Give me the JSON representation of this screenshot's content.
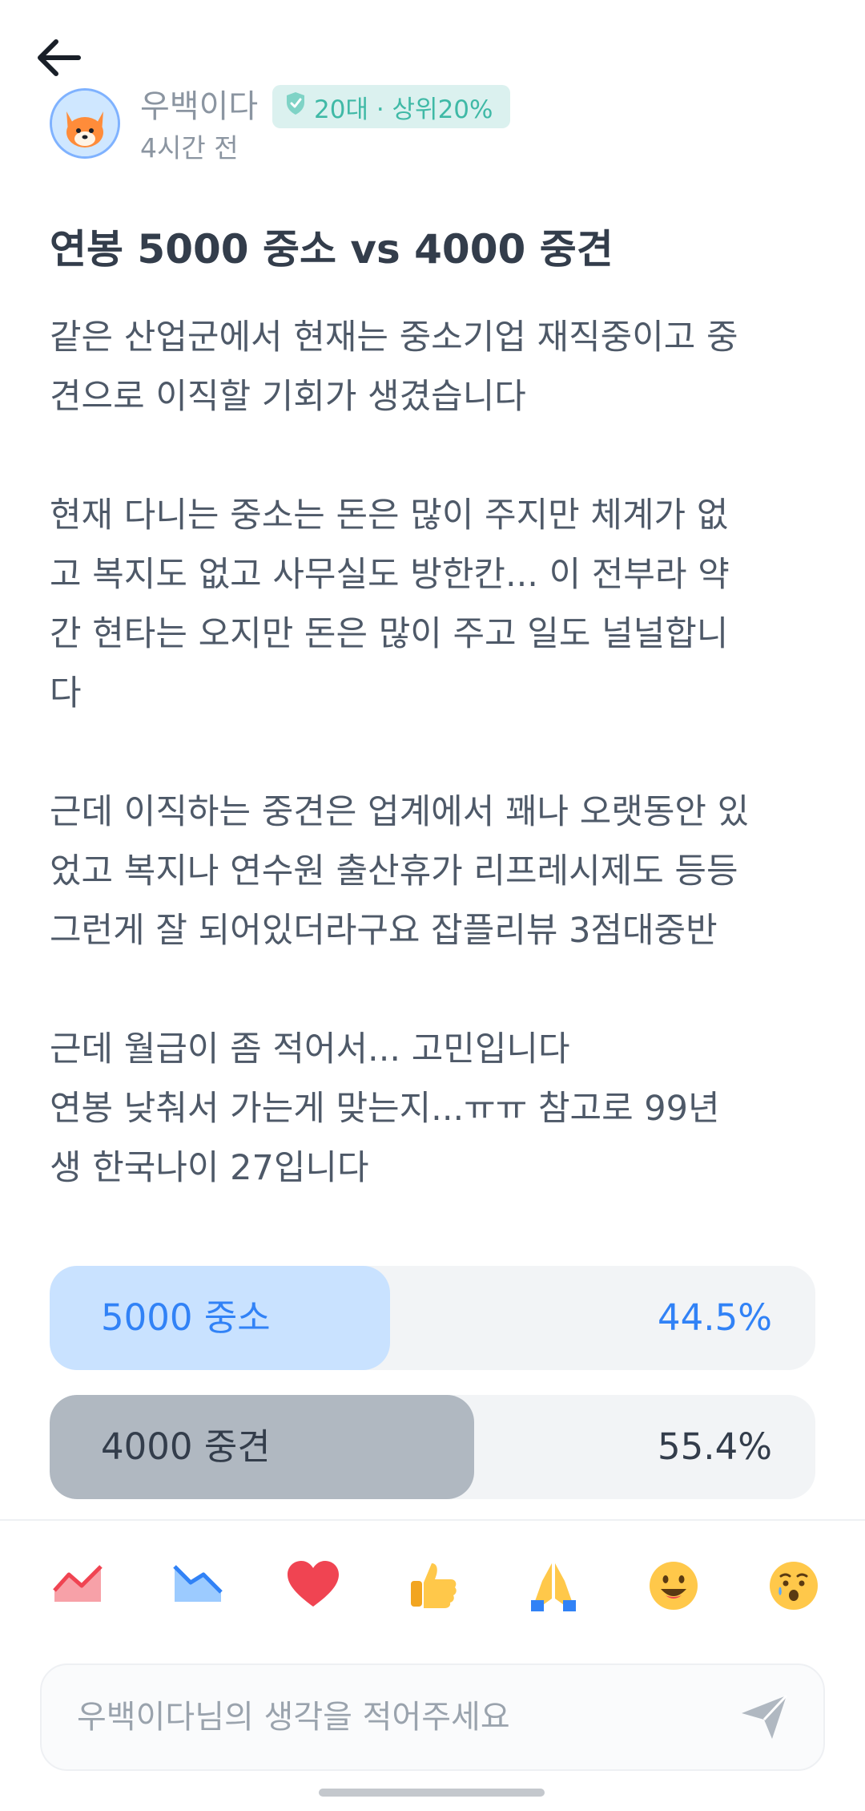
{
  "post": {
    "author": "우백이다",
    "badge": "20대 · 상위20%",
    "time": "4시간 전",
    "title": "연봉 5000 중소 vs 4000 중견",
    "content": "같은 산업군에서 현재는 중소기업 재직중이고 중\n견으로 이직할 기회가 생겼습니다\n\n현재 다니는 중소는 돈은 많이 주지만 체계가 없\n고 복지도 없고 사무실도 방한칸... 이 전부라 약\n간 현타는 오지만 돈은 많이 주고 일도 널널합니\n다\n\n근데 이직하는 중견은 업계에서 꽤나 오랫동안 있\n었고 복지나 연수원 출산휴가 리프레시제도 등등\n그런게 잘 되어있더라구요 잡플리뷰 3점대중반\n\n근데 월급이 좀 적어서... 고민입니다\n연봉 낮춰서 가는게 맞는지...ㅠㅠ 참고로 99년\n생 한국나이 27입니다"
  },
  "poll": {
    "options": [
      {
        "label": "5000 중소",
        "percent_text": "44.5%",
        "percent": 44.5,
        "fill_color": "#c9e2ff",
        "text_color": "#3182f6"
      },
      {
        "label": "4000 중견",
        "percent_text": "55.4%",
        "percent": 55.4,
        "fill_color": "#b0b8c1",
        "text_color": "#333d4b"
      }
    ]
  },
  "reactions": [
    "chart-up-icon",
    "chart-down-icon",
    "heart-icon",
    "thumbs-up-icon",
    "pray-icon",
    "smile-icon",
    "sad-icon"
  ],
  "comment": {
    "placeholder": "우백이다님의 생각을 적어주세요"
  },
  "colors": {
    "accent": "#3182f6",
    "badge_bg": "#dbf1ef",
    "badge_text": "#3fb9a6"
  }
}
